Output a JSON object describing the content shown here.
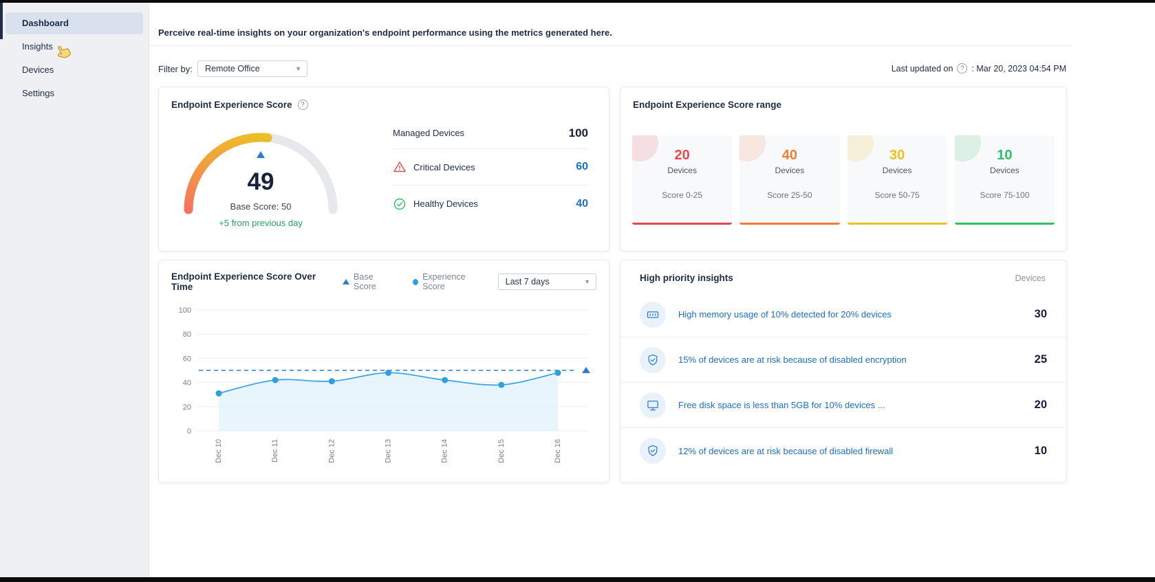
{
  "sidebar": {
    "items": [
      {
        "label": "Dashboard"
      },
      {
        "label": "Insights"
      },
      {
        "label": "Devices"
      },
      {
        "label": "Settings"
      }
    ]
  },
  "header": {
    "description": "Perceive real-time insights on your organization's endpoint performance using the metrics generated here.",
    "filter_label": "Filter by:",
    "filter_value": "Remote Office",
    "last_updated_label": "Last updated on",
    "last_updated_help": "?",
    "last_updated_value": ": Mar 20, 2023 04:54 PM"
  },
  "score_card": {
    "title": "Endpoint Experience Score",
    "help": "?",
    "score": "49",
    "base_score_label": "Base Score: 50",
    "delta_label": "+5 from previous day",
    "stats": [
      {
        "label": "Managed Devices",
        "value": "100",
        "icon": "none"
      },
      {
        "label": "Critical Devices",
        "value": "60",
        "icon": "warning-triangle"
      },
      {
        "label": "Healthy Devices",
        "value": "40",
        "icon": "check-circle"
      }
    ]
  },
  "range_card": {
    "title": "Endpoint Experience Score range",
    "ranges": [
      {
        "count": "20",
        "label": "Devices",
        "range": "Score 0-25",
        "color": "#e5484d"
      },
      {
        "count": "40",
        "label": "Devices",
        "range": "Score 25-50",
        "color": "#f07d33"
      },
      {
        "count": "30",
        "label": "Devices",
        "range": "Score 50-75",
        "color": "#e9c21b"
      },
      {
        "count": "10",
        "label": "Devices",
        "range": "Score 75-100",
        "color": "#2fbf67"
      }
    ]
  },
  "trend_card": {
    "title": "Endpoint Experience Score Over Time",
    "legend": [
      {
        "label": "Base Score",
        "marker": "triangle"
      },
      {
        "label": "Experience Score",
        "marker": "dot"
      }
    ],
    "period_value": "Last 7 days"
  },
  "chart_data": {
    "type": "line",
    "title": "Endpoint Experience Score Over Time",
    "x": [
      "Dec 10",
      "Dec 11",
      "Dec 12",
      "Dec 13",
      "Dec 14",
      "Dec 15",
      "Dec 16"
    ],
    "series": [
      {
        "name": "Experience Score",
        "values": [
          31,
          42,
          41,
          48,
          42,
          38,
          48
        ]
      },
      {
        "name": "Base Score",
        "values": [
          50,
          50,
          50,
          50,
          50,
          50,
          50
        ]
      }
    ],
    "ylim": [
      0,
      100
    ],
    "yticks": [
      0,
      20,
      40,
      60,
      80,
      100
    ],
    "grid": true,
    "area_fill": true,
    "line_color": "#3ba6e2",
    "area_color": "#e2f3fc",
    "point_color": "#2f9fe0",
    "base_line_color": "#2a7cd0",
    "legend_position": "top"
  },
  "insights_card": {
    "title": "High priority insights",
    "devices_header": "Devices",
    "items": [
      {
        "icon": "memory-icon",
        "text": "High memory usage of 10% detected for 20% devices",
        "value": "30"
      },
      {
        "icon": "shield-check-icon",
        "text": "15% of devices are at risk because of disabled encryption",
        "value": "25"
      },
      {
        "icon": "monitor-icon",
        "text": "Free disk space is less than 5GB for 10% devices ...",
        "value": "20"
      },
      {
        "icon": "shield-check-icon",
        "text": "12% of devices are at risk because of disabled firewall",
        "value": "10"
      }
    ]
  },
  "colors": {
    "accent_blue": "#1c6fc8",
    "link_blue": "#1a6fc4",
    "green": "#27a35f",
    "red": "#e5484d",
    "orange": "#f07d33",
    "yellow": "#e9c21b",
    "chart_blue": "#3ba6e2"
  }
}
